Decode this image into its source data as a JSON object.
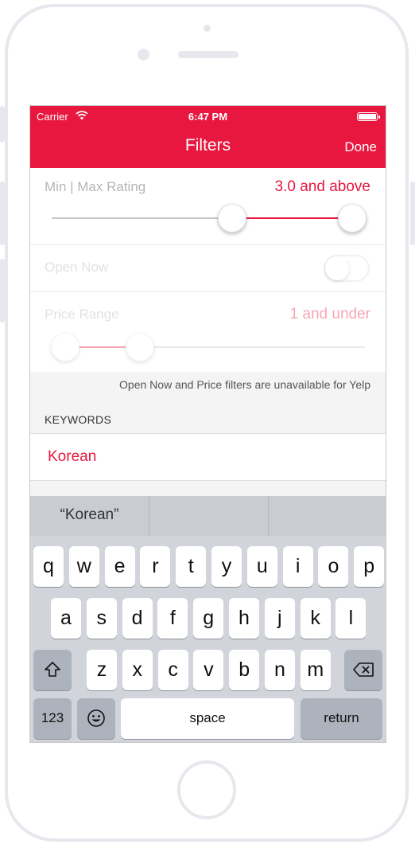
{
  "status_bar": {
    "carrier": "Carrier",
    "time": "6:47 PM"
  },
  "nav": {
    "title": "Filters",
    "done_label": "Done"
  },
  "rating": {
    "label": "Min | Max Rating",
    "value": "3.0 and above",
    "min_fraction": 0.6,
    "max_fraction": 1.0
  },
  "open_now": {
    "label": "Open Now",
    "enabled": false
  },
  "price": {
    "label": "Price Range",
    "value": "1 and under",
    "min_fraction": 0.0,
    "max_fraction": 0.25
  },
  "note": "Open Now and Price filters are unavailable for Yelp",
  "keywords": {
    "label": "KEYWORDS",
    "value": "Korean"
  },
  "keyboard": {
    "suggestions": [
      "“Korean”",
      "",
      ""
    ],
    "row1": [
      "q",
      "w",
      "e",
      "r",
      "t",
      "y",
      "u",
      "i",
      "o",
      "p"
    ],
    "row2": [
      "a",
      "s",
      "d",
      "f",
      "g",
      "h",
      "j",
      "k",
      "l"
    ],
    "row3": [
      "z",
      "x",
      "c",
      "v",
      "b",
      "n",
      "m"
    ],
    "shift_icon": "shift-icon",
    "delete_icon": "backspace-icon",
    "numbers_label": "123",
    "emoji_icon": "emoji-icon",
    "space_label": "space",
    "return_label": "return"
  },
  "colors": {
    "accent": "#e8173f"
  }
}
